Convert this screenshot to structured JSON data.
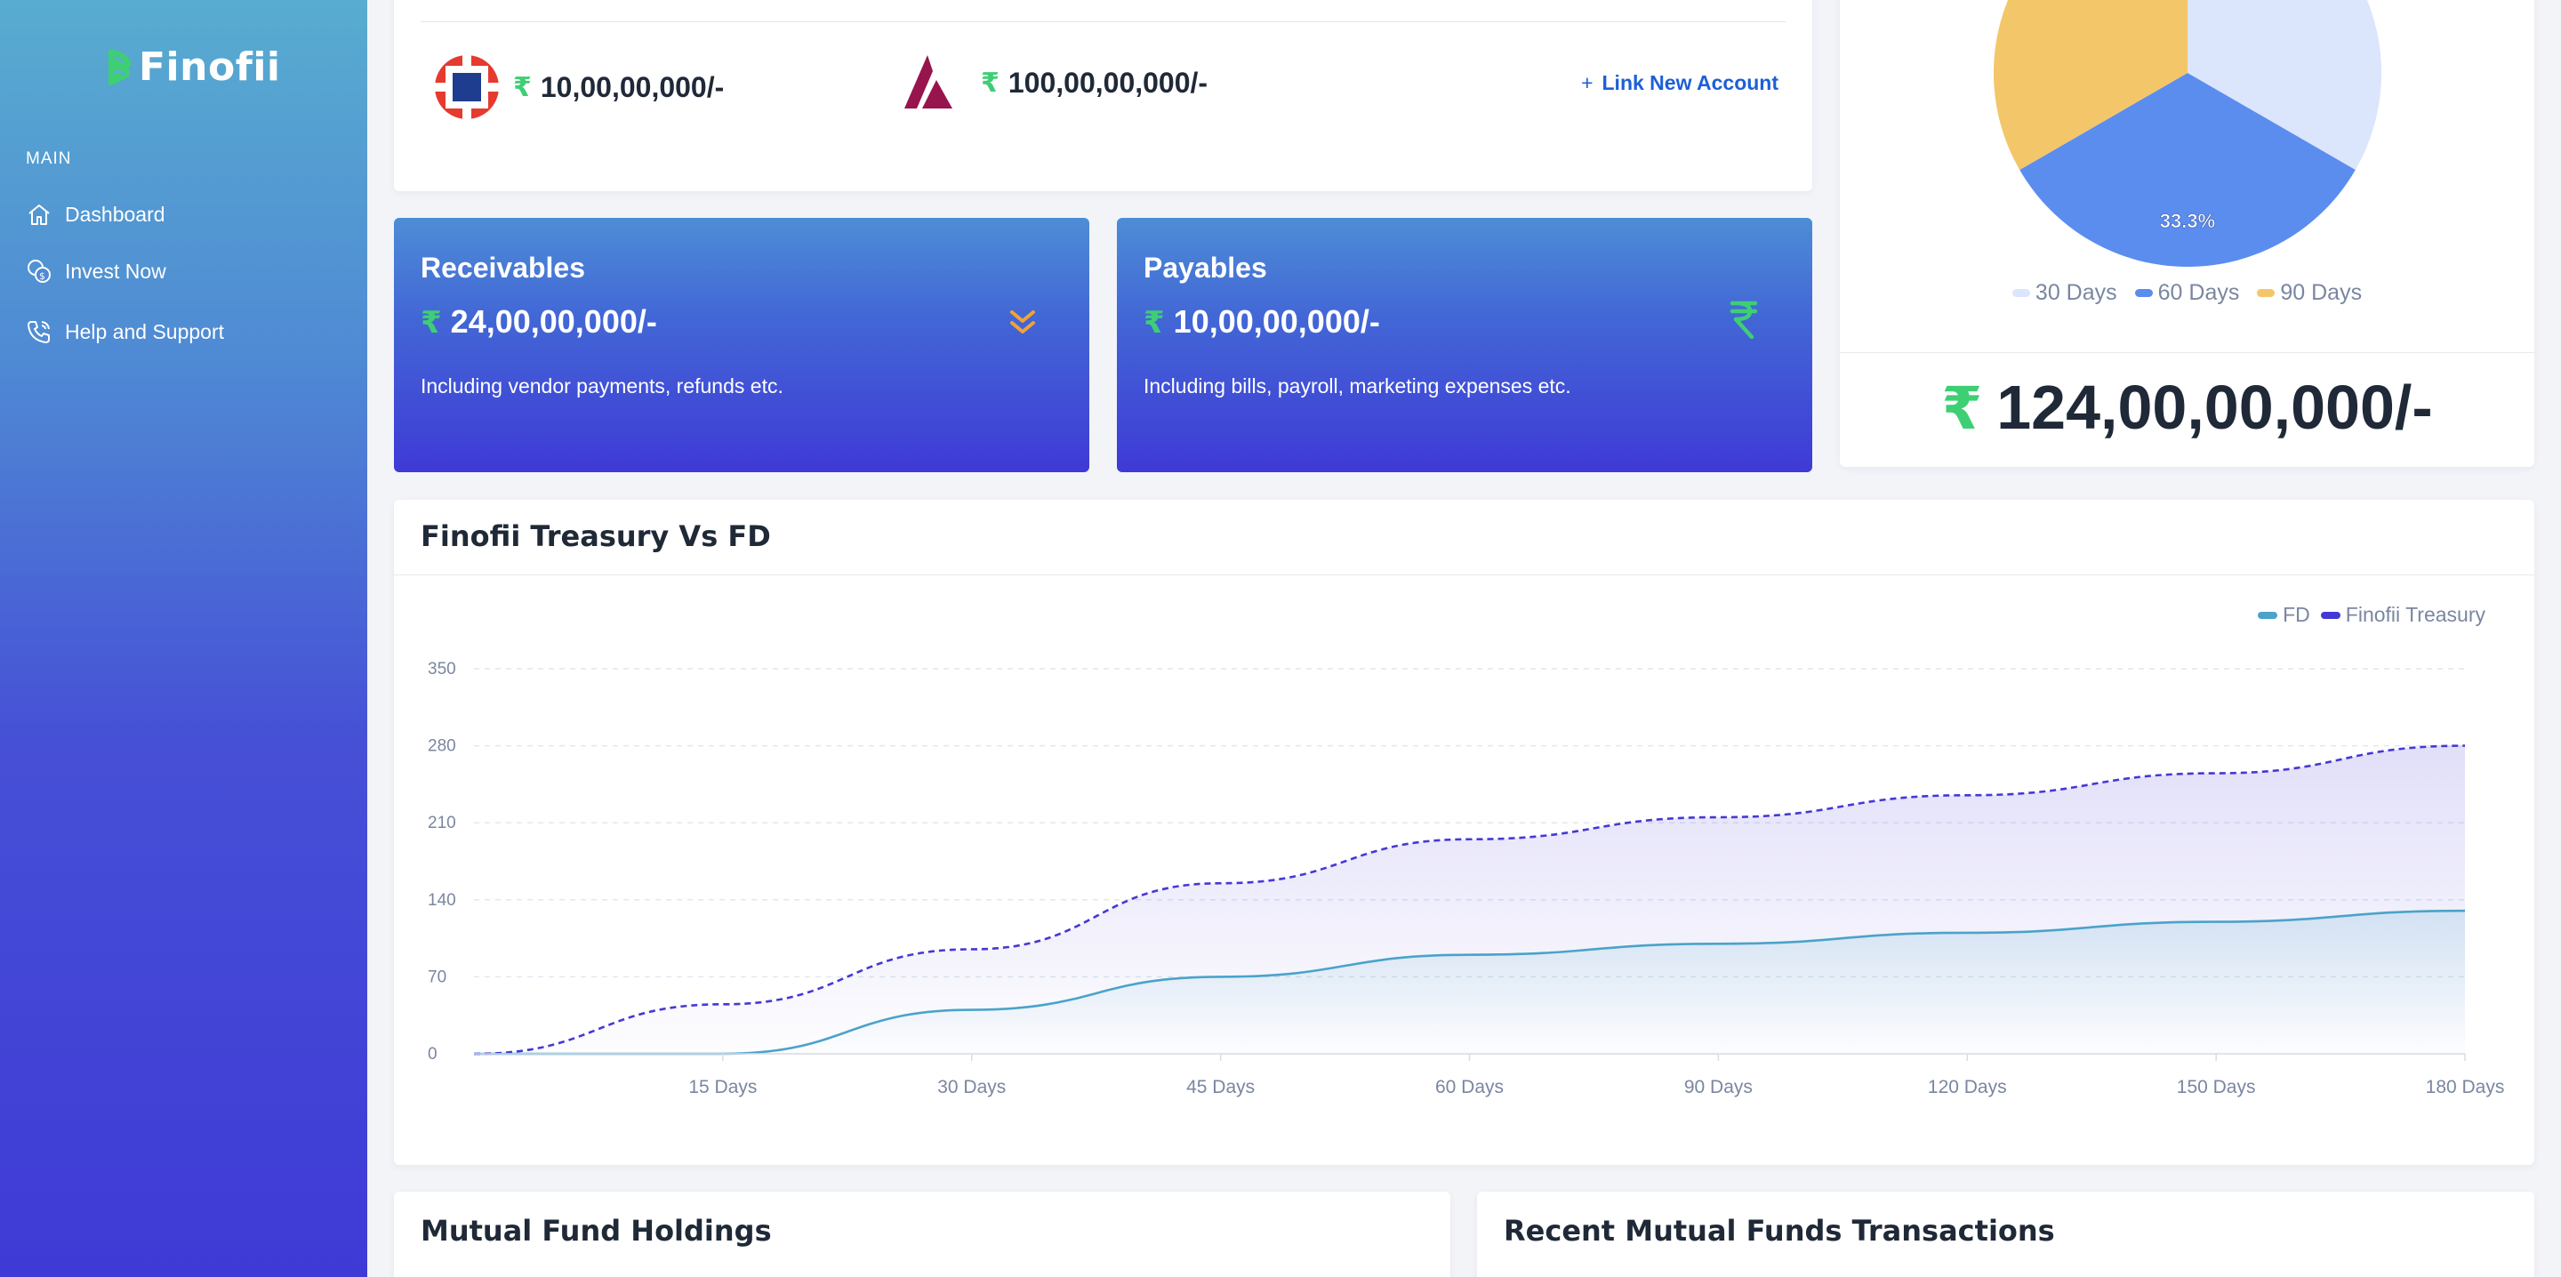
{
  "sidebar": {
    "brand": "Finofii",
    "section": "MAIN",
    "items": [
      {
        "label": "Dashboard",
        "icon": "home-icon"
      },
      {
        "label": "Invest Now",
        "icon": "coins-icon"
      },
      {
        "label": "Help and Support",
        "icon": "phone-icon"
      }
    ]
  },
  "accounts": {
    "items": [
      {
        "bank_icon": "hdfc-bank-logo-icon",
        "currency": "₹",
        "amount": "10,00,00,000/-"
      },
      {
        "bank_icon": "axis-bank-logo-icon",
        "currency": "₹",
        "amount": "100,00,00,000/-"
      }
    ],
    "link_new_plus": "+",
    "link_new_label": "Link New Account"
  },
  "receivables": {
    "title": "Receivables",
    "currency": "₹",
    "amount": "24,00,00,000/-",
    "description": "Including vendor payments, refunds etc.",
    "icon": "double-chevron-down-icon"
  },
  "payables": {
    "title": "Payables",
    "currency": "₹",
    "amount": "10,00,00,000/-",
    "description": "Including bills, payroll, marketing expenses etc.",
    "icon": "rupee-icon"
  },
  "pie": {
    "total_currency": "₹",
    "total": "124,00,00,000/-",
    "slice_label": "33.3%",
    "legend": [
      {
        "label": "30 Days",
        "color": "#dbe5fb"
      },
      {
        "label": "60 Days",
        "color": "#5b8def"
      },
      {
        "label": "90 Days",
        "color": "#f4c66a"
      }
    ],
    "colors": {
      "light": "#dbe5fb",
      "blue": "#5b8def",
      "yellow": "#f4c66a"
    }
  },
  "treasury_chart": {
    "title": "Finofii Treasury Vs FD",
    "legend": [
      {
        "label": "FD",
        "color": "#4aa3c9"
      },
      {
        "label": "Finofii Treasury",
        "color": "#4538d6"
      }
    ]
  },
  "chart_data": {
    "type": "area",
    "categories": [
      "0",
      "15 Days",
      "30 Days",
      "45 Days",
      "60 Days",
      "90 Days",
      "120 Days",
      "150 Days",
      "180 Days"
    ],
    "x_tick_labels": [
      "15 Days",
      "30 Days",
      "45 Days",
      "60 Days",
      "90 Days",
      "120 Days",
      "150 Days",
      "180 Days"
    ],
    "y_ticks": [
      "0",
      "70",
      "140",
      "210",
      "280",
      "350"
    ],
    "ylim": [
      0,
      350
    ],
    "grid": true,
    "legend_position": "top-right",
    "series": [
      {
        "name": "FD",
        "values": [
          0,
          0,
          40,
          70,
          90,
          100,
          110,
          120,
          130
        ],
        "color": "#4aa3c9",
        "style": "solid"
      },
      {
        "name": "Finofii Treasury",
        "values": [
          0,
          45,
          95,
          155,
          195,
          215,
          235,
          255,
          280
        ],
        "color": "#4538d6",
        "style": "dashed"
      }
    ]
  },
  "bottom": {
    "holdings_title": "Mutual Fund Holdings",
    "transactions_title": "Recent Mutual Funds Transactions"
  }
}
